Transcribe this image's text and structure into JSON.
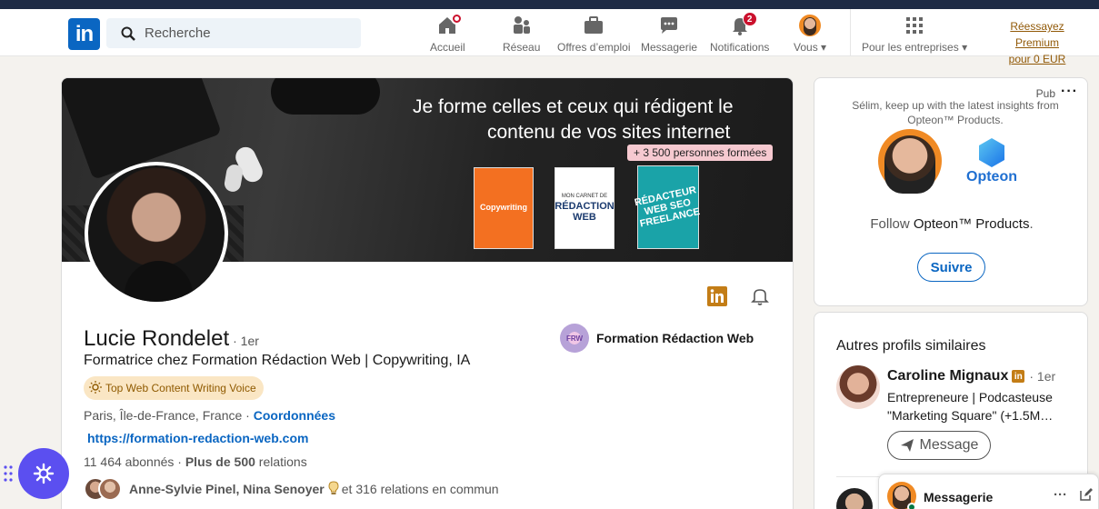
{
  "nav": {
    "search_placeholder": "Recherche",
    "items": [
      {
        "label": "Accueil"
      },
      {
        "label": "Réseau"
      },
      {
        "label": "Offres d’emploi"
      },
      {
        "label": "Messagerie"
      },
      {
        "label": "Notifications",
        "badge": "2"
      },
      {
        "label": "Vous"
      },
      {
        "label": "Pour les entreprises"
      }
    ],
    "premium_line1": "Réessayez Premium",
    "premium_line2": "pour 0 EUR"
  },
  "banner": {
    "line1": "Je forme celles et ceux qui rédigent le",
    "line2": "contenu de vos sites  internet",
    "pill": "+ 3 500 personnes formées",
    "book1_title": "Copywriting",
    "book2_title": "RÉDACTION WEB",
    "book2_pre": "MON CARNET DE",
    "book3_title": "RÉDACTEUR WEB SEO FREELANCE"
  },
  "profile": {
    "name": "Lucie Rondelet",
    "degree": "· 1er",
    "headline": "Formatrice chez Formation Rédaction Web | Copywriting, IA",
    "voice_badge": "Top Web Content Writing Voice",
    "location": "Paris, Île-de-France, France",
    "location_sep": " · ",
    "contact_link": "Coordonnées",
    "website": "https://formation-redaction-web.com",
    "followers": "11 464 abonnés",
    "connections_prefix": " · ",
    "connections_bold": "Plus de 500",
    "connections_suffix": " relations",
    "mutual_names": "Anne-Sylvie Pinel, Nina Senoyer",
    "mutual_rest": " et 316 relations en commun",
    "company": "Formation Rédaction Web"
  },
  "ad": {
    "pub": "Pub",
    "text": "Sélim, keep up with the latest insights from Opteon™ Products.",
    "logo_name": "Opteon",
    "follow_prefix": "Follow ",
    "follow_brand": "Opteon™ Products",
    "follow_suffix": ".",
    "button": "Suivre"
  },
  "similar": {
    "title": "Autres profils similaires",
    "name": "Caroline Mignaux",
    "badge": "in",
    "degree": "· 1er",
    "desc": "Entrepreneure | Podcasteuse \"Marketing Square\" (+1.5M…",
    "button": "Message"
  },
  "messaging": {
    "label": "Messagerie",
    "dots": "···"
  },
  "colors": {
    "brand": "#0a66c2",
    "premium": "#915907",
    "badge_red": "#cb112d",
    "fab": "#5b4ff0"
  }
}
